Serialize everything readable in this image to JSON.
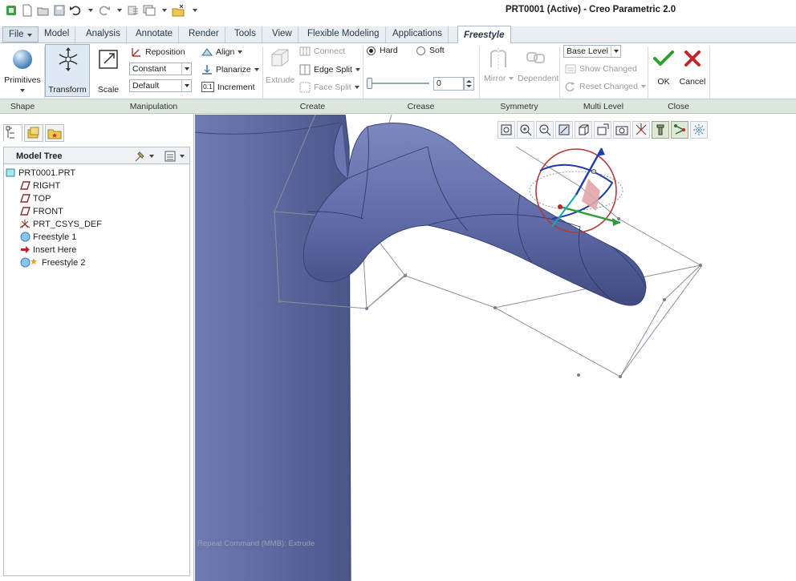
{
  "window": {
    "title": "PRT0001 (Active) - Creo Parametric 2.0"
  },
  "quick_access": {
    "icons": [
      "app-icon",
      "new-icon",
      "open-icon",
      "save-icon",
      "undo-icon",
      "redo-icon",
      "regenerate-icon",
      "windows-icon",
      "close-window-icon",
      "customize-icon"
    ]
  },
  "tabs": [
    {
      "label": "File"
    },
    {
      "label": "Model"
    },
    {
      "label": "Analysis"
    },
    {
      "label": "Annotate"
    },
    {
      "label": "Render"
    },
    {
      "label": "Tools"
    },
    {
      "label": "View"
    },
    {
      "label": "Flexible Modeling"
    },
    {
      "label": "Applications"
    },
    {
      "label": "Freestyle"
    }
  ],
  "ribbon": {
    "shape": {
      "primitives": "Primitives"
    },
    "manipulation": {
      "transform": "Transform",
      "scale": "Scale",
      "reposition": "Reposition",
      "constant": "Constant",
      "default": "Default",
      "align": "Align",
      "planarize": "Planarize",
      "increment": "Increment",
      "increment_icon": "0.1"
    },
    "create": {
      "extrude": "Extrude",
      "connect": "Connect",
      "edge_split": "Edge Split",
      "face_split": "Face Split"
    },
    "crease": {
      "hard": "Hard",
      "soft": "Soft",
      "value": "0",
      "hard_selected": true
    },
    "symmetry": {
      "mirror": "Mirror",
      "dependent": "Dependent"
    },
    "multi_level": {
      "base_level": "Base Level",
      "show_changed": "Show Changed",
      "reset_changed": "Reset Changed"
    },
    "close": {
      "ok": "OK",
      "cancel": "Cancel"
    }
  },
  "groups": {
    "shape": "Shape",
    "manipulation": "Manipulation",
    "create": "Create",
    "crease": "Crease",
    "symmetry": "Symmetry",
    "multi_level": "Multi Level",
    "close": "Close"
  },
  "model_tree": {
    "title": "Model Tree",
    "items": [
      {
        "label": "PRT0001.PRT",
        "icon": "part-icon"
      },
      {
        "label": "RIGHT",
        "icon": "datum-plane-icon"
      },
      {
        "label": "TOP",
        "icon": "datum-plane-icon"
      },
      {
        "label": "FRONT",
        "icon": "datum-plane-icon"
      },
      {
        "label": "PRT_CSYS_DEF",
        "icon": "csys-icon"
      },
      {
        "label": "Freestyle 1",
        "icon": "freestyle-icon"
      },
      {
        "label": "Insert Here",
        "icon": "insert-arrow-icon"
      },
      {
        "label": "Freestyle 2",
        "icon": "freestyle-active-icon"
      }
    ]
  },
  "graphics": {
    "status_hint": "Repeat Command (MMB): Extrude",
    "view_toolbar": [
      "refit-icon",
      "zoom-in-icon",
      "zoom-out-icon",
      "repaint-icon",
      "display-style-icon",
      "saved-orientations-icon",
      "view-manager-icon",
      "datum-display-icon",
      "spin-center-icon",
      "control-mesh-icon",
      "smooth-mesh-icon",
      "wireframe-icon"
    ]
  },
  "colors": {
    "model_fill": "#5e6aa3",
    "model_highlight": "#8a93c6",
    "ribbon_footer": "#dbe7dd",
    "ok_green": "#2ca02c",
    "cancel_red": "#c0272d"
  }
}
